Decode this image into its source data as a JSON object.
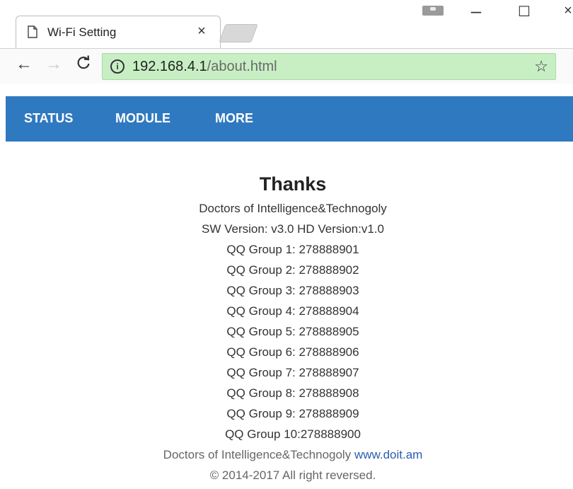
{
  "browser": {
    "tab_title": "Wi-Fi Setting",
    "tab_close": "×",
    "url_host": "192.168.4.1",
    "url_path": "/about.html",
    "window_minimize": "–",
    "window_maximize": "☐",
    "window_close": "×"
  },
  "navbar": {
    "items": [
      {
        "label": "STATUS"
      },
      {
        "label": "MODULE"
      },
      {
        "label": "MORE"
      }
    ]
  },
  "content": {
    "heading": "Thanks",
    "company": "Doctors of Intelligence&Technogoly",
    "version": "SW Version: v3.0 HD Version:v1.0",
    "qq_groups": [
      "QQ Group 1: 278888901",
      "QQ Group 2: 278888902",
      "QQ Group 3: 278888903",
      "QQ Group 4: 278888904",
      "QQ Group 5: 278888905",
      "QQ Group 6: 278888906",
      "QQ Group 7: 278888907",
      "QQ Group 8: 278888908",
      "QQ Group 9: 278888909",
      "QQ Group 10:278888900"
    ]
  },
  "footer": {
    "company": "Doctors of Intelligence&Technogoly",
    "link_text": "www.doit.am",
    "copyright": "© 2014-2017 All right reversed."
  },
  "icons": {
    "page": "page-icon",
    "back": "arrow-left-icon",
    "forward": "arrow-right-icon",
    "reload": "reload-icon",
    "info": "info-icon",
    "star": "star-icon",
    "profile": "profile-icon"
  },
  "colors": {
    "navbar_bg": "#2f79c0",
    "omnibox_bg": "#c8efc4",
    "link": "#2a5db0"
  }
}
